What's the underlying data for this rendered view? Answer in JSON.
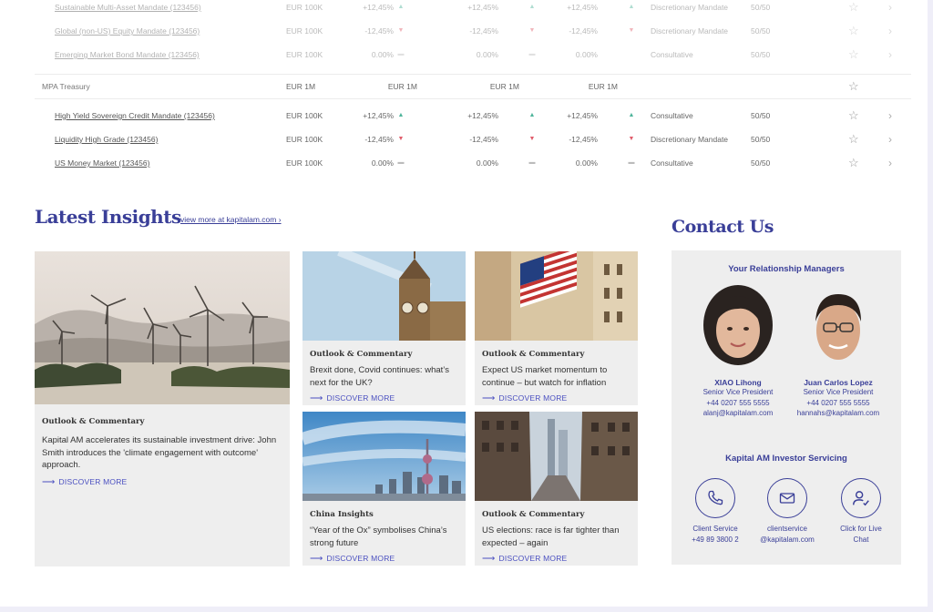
{
  "table": {
    "rows": [
      {
        "kind": "fund",
        "faded": true,
        "name": "Sustainable Multi-Asset Mandate (123456)",
        "currency": "EUR 100K",
        "perf1": "+12,45%",
        "dir1": "up",
        "perf2": "+12,45%",
        "dir2": "up",
        "perf3": "+12,45%",
        "dir3": "up",
        "type": "Discretionary Mandate",
        "split": "50/50"
      },
      {
        "kind": "fund",
        "faded": true,
        "name": "Global (non-US) Equity Mandate (123456)",
        "currency": "EUR 100K",
        "perf1": "-12,45%",
        "dir1": "down",
        "perf2": "-12,45%",
        "dir2": "down",
        "perf3": "-12,45%",
        "dir3": "down",
        "type": "Discretionary Mandate",
        "split": "50/50"
      },
      {
        "kind": "fund",
        "faded": true,
        "name": "Emerging Market Bond Mandate (123456)",
        "currency": "EUR 100K",
        "perf1": "0.00%",
        "dir1": "flat",
        "perf2": "0.00%",
        "dir2": "flat",
        "perf3": "0.00%",
        "dir3": "flat",
        "type": "Consultative",
        "split": "50/50"
      },
      {
        "kind": "group",
        "faded": false,
        "name": "MPA Treasury",
        "currency": "EUR 1M",
        "perf1": "EUR 1M",
        "dir1": "",
        "perf2": "EUR 1M",
        "dir2": "",
        "perf3": "EUR 1M",
        "dir3": "",
        "type": "",
        "split": ""
      },
      {
        "kind": "fund",
        "faded": false,
        "name": "High Yield Sovereign Credit Mandate (123456)",
        "currency": "EUR 100K",
        "perf1": "+12,45%",
        "dir1": "up",
        "perf2": "+12,45%",
        "dir2": "up",
        "perf3": "+12,45%",
        "dir3": "up",
        "type": "Consultative",
        "split": "50/50"
      },
      {
        "kind": "fund",
        "faded": false,
        "name": "Liquidity High Grade (123456)",
        "currency": "EUR 100K",
        "perf1": "-12,45%",
        "dir1": "down",
        "perf2": "-12,45%",
        "dir2": "down",
        "perf3": "-12,45%",
        "dir3": "down",
        "type": "Discretionary Mandate",
        "split": "50/50"
      },
      {
        "kind": "fund",
        "faded": false,
        "name": "US Money Market (123456)",
        "currency": "EUR 100K",
        "perf1": "0.00%",
        "dir1": "flat",
        "perf2": "0.00%",
        "dir2": "flat",
        "perf3": "0.00%",
        "dir3": "flat",
        "type": "Consultative",
        "split": "50/50"
      }
    ],
    "star_glyph": "☆",
    "chevron_glyph": "›",
    "colors": {
      "up": "#4fb59b",
      "down": "#e05d6b",
      "flat": "#bbbbbb"
    }
  },
  "insights": {
    "title": "Latest Insights",
    "view_more": "view more at kapitalam.com ›",
    "discover_label": "DISCOVER MORE",
    "arrow_glyph": "⟶",
    "cards": [
      {
        "category": "Outlook & Commentary",
        "text": "Kapital AM accelerates its sustainable investment drive: John Smith introduces the 'climate engagement with outcome' approach.",
        "image": "wind-turbines-image"
      },
      {
        "category": "Outlook & Commentary",
        "text": "Brexit done, Covid continues: what’s next for the UK?",
        "image": "big-ben-image"
      },
      {
        "category": "Outlook & Commentary",
        "text": "Expect US market momentum to continue – but watch for inflation",
        "image": "stock-exchange-flag-image"
      },
      {
        "category": "China Insights",
        "text": "“Year of the Ox” symbolises China’s strong future",
        "image": "shanghai-skyline-image"
      },
      {
        "category": "Outlook & Commentary",
        "text": "US elections: race is far tighter than expected – again",
        "image": "city-street-image"
      }
    ],
    "accent_color": "#3a3f98"
  },
  "contact": {
    "title": "Contact Us",
    "managers_heading": "Your Relationship Managers",
    "managers": [
      {
        "name": "XIAO Lihong",
        "role": "Senior Vice President",
        "phone": "+44 0207 555 5555",
        "email": "alanj@kapitalam.com"
      },
      {
        "name": "Juan Carlos Lopez",
        "role": "Senior Vice President",
        "phone": "+44 0207 555 5555",
        "email": "hannahs@kapitalam.com"
      }
    ],
    "servicing_heading": "Kapital AM Investor Servicing",
    "services": [
      {
        "icon": "phone-icon",
        "line1": "Client Service",
        "line2": "+49 89 3800 2"
      },
      {
        "icon": "mail-icon",
        "line1": "clientservice",
        "line2": "@kapitalam.com"
      },
      {
        "icon": "chat-user-icon",
        "line1": "Click for Live",
        "line2": "Chat"
      }
    ]
  }
}
